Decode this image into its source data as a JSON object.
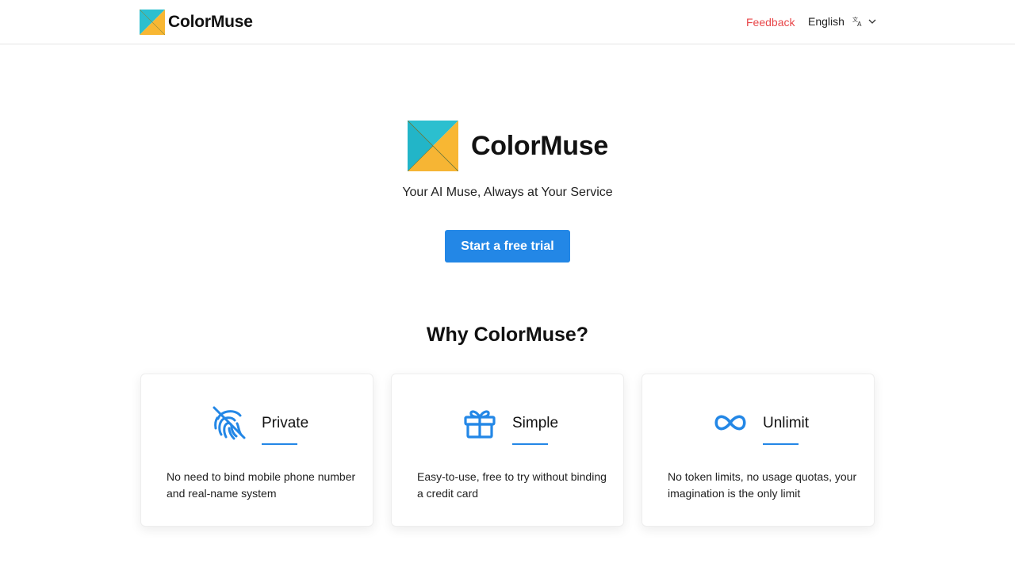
{
  "header": {
    "brand_name": "ColorMuse",
    "feedback_label": "Feedback",
    "language_label": "English"
  },
  "hero": {
    "title": "ColorMuse",
    "tagline": "Your AI Muse, Always at Your Service",
    "cta_label": "Start a free trial"
  },
  "features": {
    "title": "Why ColorMuse?",
    "cards": [
      {
        "icon": "fingerprint-off-icon",
        "title": "Private",
        "description": "No need to bind mobile phone number and real-name system"
      },
      {
        "icon": "gift-icon",
        "title": "Simple",
        "description": "Easy-to-use, free to try without binding a credit card"
      },
      {
        "icon": "infinity-icon",
        "title": "Unlimit",
        "description": "No token limits, no usage quotas, your imagination is the only limit"
      }
    ]
  },
  "colors": {
    "accent": "#2387e6",
    "feedback": "#e8474a",
    "logo_teal": "#2bbfcf",
    "logo_yellow": "#f8b733"
  }
}
